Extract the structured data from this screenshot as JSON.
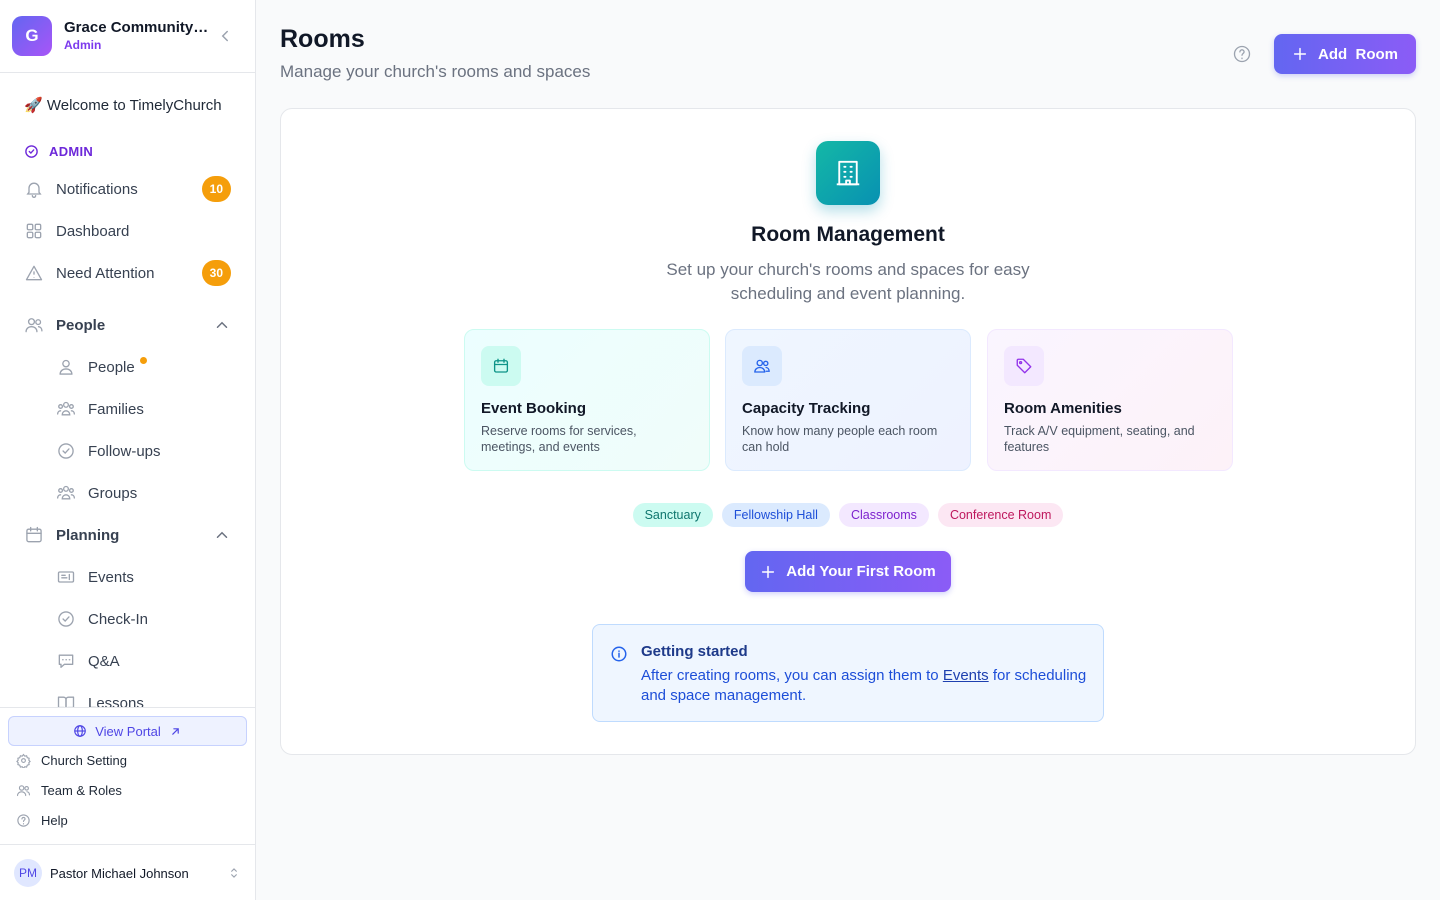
{
  "org": {
    "initial": "G",
    "name": "Grace Community Church",
    "role": "Admin"
  },
  "nav": {
    "welcome": "🚀 Welcome to TimelyChurch",
    "section": "ADMIN",
    "notifications": {
      "label": "Notifications",
      "badge": "10"
    },
    "dashboard": "Dashboard",
    "need_attention": {
      "label": "Need Attention",
      "badge": "30"
    },
    "people_group": "People",
    "people_items": [
      "People",
      "Families",
      "Follow-ups",
      "Groups"
    ],
    "planning_group": "Planning",
    "planning_items": [
      "Events",
      "Check-In",
      "Q&A",
      "Lessons"
    ]
  },
  "bottom": {
    "portal": "View Portal",
    "church_setting": "Church Setting",
    "team_roles": "Team & Roles",
    "help": "Help",
    "user_initials": "PM",
    "user_name": "Pastor Michael Johnson"
  },
  "header": {
    "title": "Rooms",
    "subtitle": "Manage your church's rooms and spaces",
    "add_button": "Add  Room"
  },
  "empty": {
    "title": "Room Management",
    "desc": "Set up your church's rooms and spaces for easy scheduling and event planning.",
    "features": [
      {
        "title": "Event Booking",
        "desc": "Reserve rooms for services, meetings, and events",
        "icon": "calendar-icon"
      },
      {
        "title": "Capacity Tracking",
        "desc": "Know how many people each room can hold",
        "icon": "users-icon"
      },
      {
        "title": "Room Amenities",
        "desc": "Track A/V equipment, seating, and features",
        "icon": "tag-icon"
      }
    ],
    "chips": [
      "Sanctuary",
      "Fellowship Hall",
      "Classrooms",
      "Conference Room"
    ],
    "cta": "Add Your First Room"
  },
  "info": {
    "title": "Getting started",
    "text_before": "After creating rooms, you can assign them to ",
    "link": "Events",
    "text_after": " for scheduling and space management."
  },
  "colors": {
    "primary": "#6366f1",
    "accent_purple": "#8b5cf6",
    "badge": "#f59e0b",
    "teal": "#14b8a6"
  }
}
